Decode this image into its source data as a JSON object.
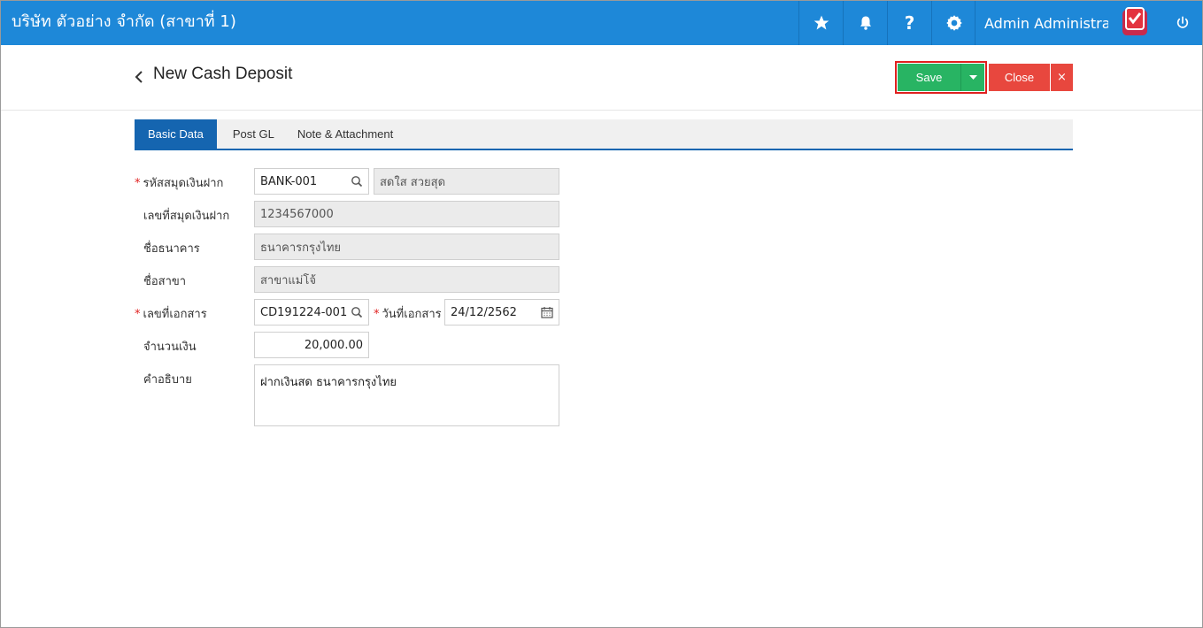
{
  "topbar": {
    "company": "บริษัท ตัวอย่าง จำกัด (สาขาที่ 1)",
    "user": "Admin Administrator",
    "icons": [
      "star-icon",
      "bell-icon",
      "help-icon",
      "gear-icon",
      "power-icon"
    ],
    "help_label": "?"
  },
  "header": {
    "title": "New Cash Deposit",
    "save_label": "Save",
    "close_label": "Close",
    "close_x": "×"
  },
  "tabs": [
    {
      "label": "Basic Data",
      "active": true
    },
    {
      "label": "Post GL",
      "active": false
    },
    {
      "label": "Note & Attachment",
      "active": false
    }
  ],
  "form": {
    "passbook_code_label": "รหัสสมุดเงินฝาก",
    "passbook_code": "BANK-001",
    "passbook_name": "สดใส สวยสุด",
    "passbook_no_label": "เลขที่สมุดเงินฝาก",
    "passbook_no": "1234567000",
    "bank_name_label": "ชื่อธนาคาร",
    "bank_name": "ธนาคารกรุงไทย",
    "branch_name_label": "ชื่อสาขา",
    "branch_name": "สาขาแม่โจ้",
    "doc_no_label": "เลขที่เอกสาร",
    "doc_no": "CD191224-001",
    "doc_date_label": "วันที่เอกสาร",
    "doc_date": "24/12/2562",
    "amount_label": "จำนวนเงิน",
    "amount": "20,000.00",
    "description_label": "คำอธิบาย",
    "description": "ฝากเงินสด ธนาคารกรุงไทย",
    "required_mark": "*"
  },
  "colors": {
    "topbar": "#1e88d8",
    "save": "#28b463",
    "close": "#e8473e",
    "tab_active": "#1565b0",
    "highlight": "#e0201f"
  }
}
